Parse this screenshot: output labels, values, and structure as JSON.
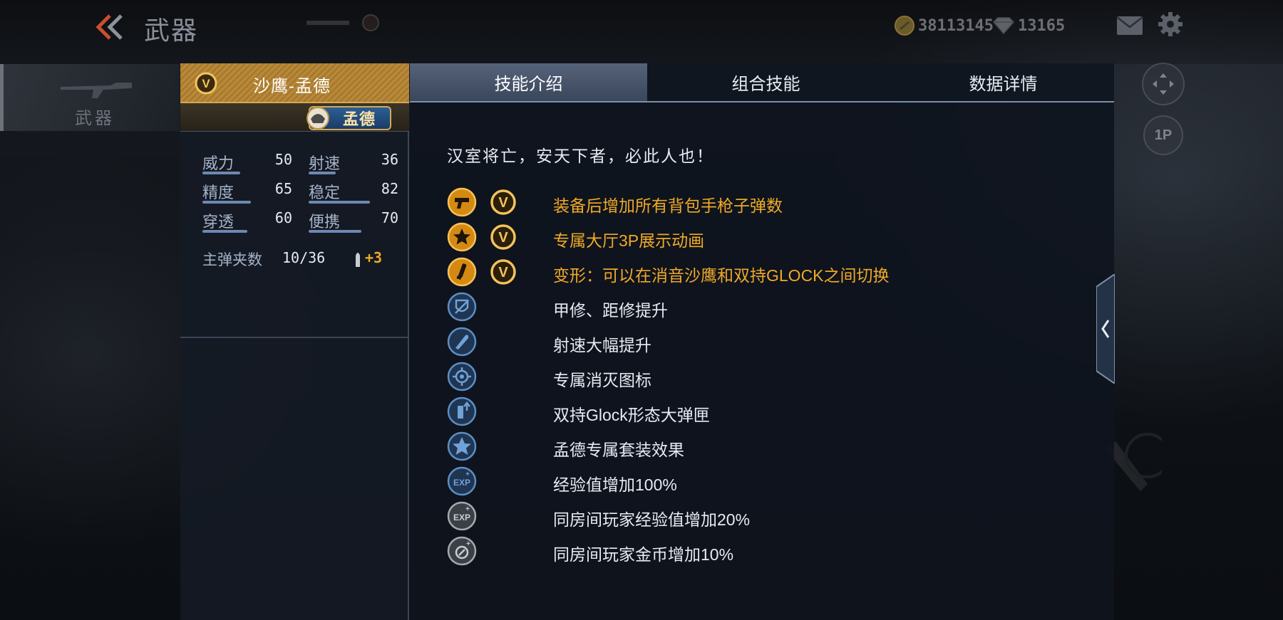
{
  "header": {
    "title": "武器",
    "gold_amount": "38113145",
    "diamond_amount": "13165"
  },
  "side_nav": {
    "active_item": "武器"
  },
  "right_icons": {
    "view_label": "1P"
  },
  "weapon": {
    "name": "沙鹰-孟德",
    "tag": "孟德",
    "stats": [
      {
        "label": "威力",
        "value": "50",
        "level": 0.5
      },
      {
        "label": "射速",
        "value": "36",
        "level": 0.36
      },
      {
        "label": "精度",
        "value": "65",
        "level": 0.65
      },
      {
        "label": "稳定",
        "value": "82",
        "level": 0.82
      },
      {
        "label": "穿透",
        "value": "60",
        "level": 0.6
      },
      {
        "label": "便携",
        "value": "70",
        "level": 0.7
      }
    ],
    "ammo_label": "主弹夹数",
    "ammo_value": "10/36",
    "ammo_bonus": "+3"
  },
  "tabs": [
    {
      "label": "技能介绍",
      "active": true
    },
    {
      "label": "组合技能",
      "active": false
    },
    {
      "label": "数据详情",
      "active": false
    }
  ],
  "content": {
    "quote": "汉室将亡，安天下者，必此人也！",
    "skills": [
      {
        "icon": "pistol-icon",
        "style": "gold",
        "v_badge": true,
        "text": "装备后增加所有背包手枪子弹数"
      },
      {
        "icon": "star-icon",
        "style": "gold",
        "v_badge": true,
        "text": "专属大厅3P展示动画"
      },
      {
        "icon": "transform-icon",
        "style": "gold",
        "v_badge": true,
        "text": "变形：可以在消音沙鹰和双持GLOCK之间切换"
      },
      {
        "icon": "armor-repair-icon",
        "style": "blue",
        "v_badge": false,
        "text": "甲修、距修提升"
      },
      {
        "icon": "bullet-speed-icon",
        "style": "blue",
        "v_badge": false,
        "text": "射速大幅提升"
      },
      {
        "icon": "kill-mark-icon",
        "style": "blue",
        "v_badge": false,
        "text": "专属消灭图标"
      },
      {
        "icon": "magazine-up-icon",
        "style": "blue",
        "v_badge": false,
        "text": "双持Glock形态大弹匣"
      },
      {
        "icon": "set-star-icon",
        "style": "blue",
        "v_badge": false,
        "text": "孟德专属套装效果"
      },
      {
        "icon": "exp-icon",
        "style": "blue",
        "v_badge": false,
        "text": "经验值增加100%"
      },
      {
        "icon": "room-exp-icon",
        "style": "grey",
        "v_badge": false,
        "text": "同房间玩家经验值增加20%"
      },
      {
        "icon": "room-coin-icon",
        "style": "grey",
        "v_badge": false,
        "text": "同房间玩家金币增加10%"
      }
    ]
  },
  "colors": {
    "gold_text": "#f0a928",
    "normal_text": "#e7ebf2",
    "blue_icon": "#5b8ec4",
    "grey_icon": "#9aa0a8"
  }
}
